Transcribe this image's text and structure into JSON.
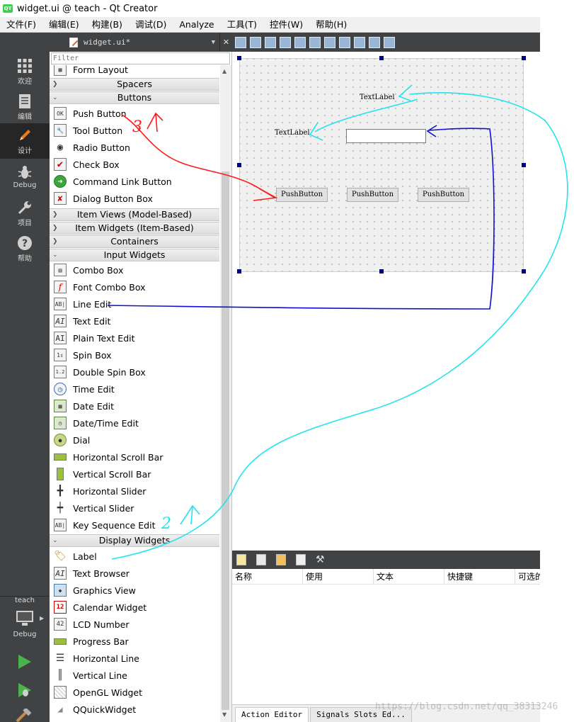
{
  "window": {
    "title": "widget.ui @ teach - Qt Creator",
    "logo_text": "QT"
  },
  "menu": [
    "文件(F)",
    "编辑(E)",
    "构建(B)",
    "调试(D)",
    "Analyze",
    "工具(T)",
    "控件(W)",
    "帮助(H)"
  ],
  "modes": [
    {
      "label": "欢迎",
      "icon": "grid-icon"
    },
    {
      "label": "编辑",
      "icon": "document-icon"
    },
    {
      "label": "设计",
      "icon": "pencil-icon"
    },
    {
      "label": "Debug",
      "icon": "bug-icon"
    },
    {
      "label": "项目",
      "icon": "wrench-icon"
    },
    {
      "label": "帮助",
      "icon": "question-icon"
    }
  ],
  "kit": {
    "project": "teach",
    "config": "Debug"
  },
  "document": {
    "name": "widget.ui*",
    "close_glyph": "✕"
  },
  "filter": {
    "placeholder": "Filter"
  },
  "widgetbox": {
    "partial_item": "Form Layout",
    "cat_spacers": "Spacers",
    "cat_buttons": "Buttons",
    "buttons": [
      "Push Button",
      "Tool Button",
      "Radio Button",
      "Check Box",
      "Command Link Button",
      "Dialog Button Box"
    ],
    "cat_item_views": "Item Views (Model-Based)",
    "cat_item_widgets": "Item Widgets (Item-Based)",
    "cat_containers": "Containers",
    "cat_input": "Input Widgets",
    "input": [
      "Combo Box",
      "Font Combo Box",
      "Line Edit",
      "Text Edit",
      "Plain Text Edit",
      "Spin Box",
      "Double Spin Box",
      "Time Edit",
      "Date Edit",
      "Date/Time Edit",
      "Dial",
      "Horizontal Scroll Bar",
      "Vertical Scroll Bar",
      "Horizontal Slider",
      "Vertical Slider",
      "Key Sequence Edit"
    ],
    "cat_display": "Display Widgets",
    "display": [
      "Label",
      "Text Browser",
      "Graphics View",
      "Calendar Widget",
      "LCD Number",
      "Progress Bar",
      "Horizontal Line",
      "Vertical Line",
      "OpenGL Widget",
      "QQuickWidget"
    ]
  },
  "form": {
    "label1": "TextLabel",
    "label2": "TextLabel",
    "buttons": [
      "PushButton",
      "PushButton",
      "PushButton"
    ]
  },
  "action_editor": {
    "columns": [
      "名称",
      "使用",
      "文本",
      "快捷键",
      "可选的"
    ],
    "tabs": [
      "Action Editor",
      "Signals Slots Ed..."
    ]
  },
  "annotations": {
    "step3": "3",
    "step2": "2"
  },
  "colors": {
    "red": "#ff1a1a",
    "cyan": "#22e3f0",
    "blue": "#1010d0",
    "dark": "#404244",
    "handle": "#000080"
  },
  "watermark": "https://blog.csdn.net/qq_38313246"
}
